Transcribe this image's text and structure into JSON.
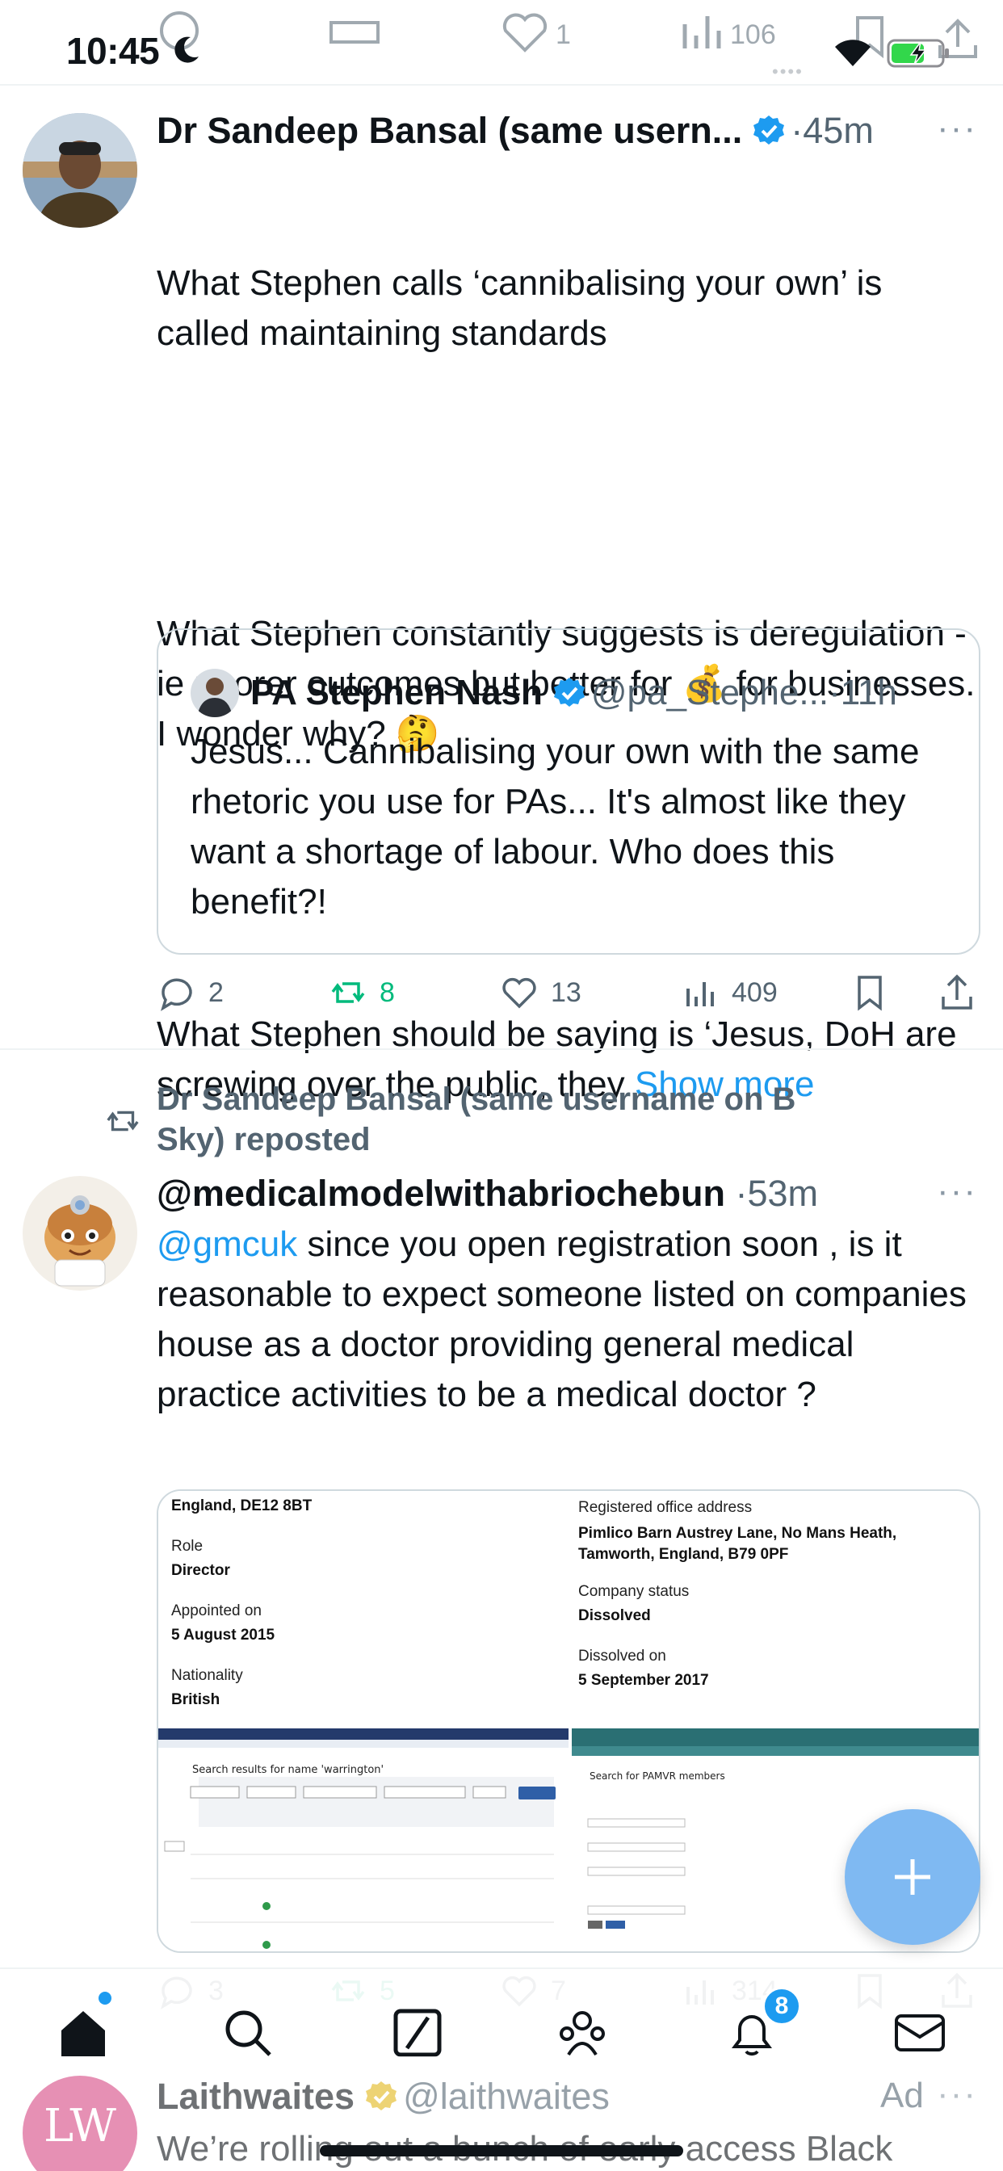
{
  "status_bar": {
    "time": "10:45"
  },
  "top_actions": {
    "retweets": "",
    "likes": "1",
    "views": "106"
  },
  "tweet1": {
    "author": "Dr Sandeep Bansal (same usern...",
    "time": "45m",
    "text_p1": "What Stephen calls ‘cannibalising your own’ is called maintaining standards",
    "text_p2": "What Stephen constantly suggests is deregulation - ie poorer outcomes but better for 💰 for businesses. I wonder why? 🤔",
    "text_p3": "What Stephen should be saying is ‘Jesus, DoH are screwing over the public, they",
    "show_more": "Show more",
    "quote": {
      "author": "PA Stephen Nash",
      "handle": "@pa_Stephe...",
      "time": "11h",
      "text": "Jesus... Cannibalising your own with the same rhetoric you use for PAs... It's almost like they want a shortage of labour. Who does this benefit?!"
    },
    "actions": {
      "replies": "2",
      "reposts": "8",
      "likes": "13",
      "views": "409"
    }
  },
  "tweet2": {
    "repost_banner": "Dr Sandeep Bansal (same username on B Sky) reposted",
    "author": "@medicalmodelwithabriochebun",
    "time": "53m",
    "mention": "@gmcuk",
    "text": " since you open registration soon , is it reasonable to expect someone listed on companies house as a doctor providing general medical practice activities to be a medical doctor ?",
    "media": {
      "doc1": {
        "address": "England, DE12 8BT",
        "role_label": "Role",
        "role_value": "Director",
        "appointed_label": "Appointed on",
        "appointed_value": "5 August 2015",
        "nationality_label": "Nationality",
        "nationality_value": "British"
      },
      "doc2": {
        "office_label": "Registered office address",
        "office_value": "Pimlico Barn Austrey Lane, No Mans Heath, Tamworth, England, B79 0PF",
        "status_label": "Company status",
        "status_value": "Dissolved",
        "dissolved_label": "Dissolved on",
        "dissolved_value": "5 September 2017"
      },
      "doc3": {
        "title": "Search results for name 'warrington'"
      },
      "doc4": {
        "title": "Search for PAMVR members"
      }
    },
    "actions": {
      "replies": "3",
      "reposts": "5",
      "likes": "7",
      "views": "314"
    }
  },
  "nav": {
    "notifications_badge": "8"
  },
  "ad": {
    "avatar_text": "LW",
    "author": "Laithwaites",
    "handle": "@laithwaites",
    "label": "Ad",
    "text": "We’re rolling out a bunch of early access Black"
  },
  "colors": {
    "accent": "#1d9bf0",
    "repost_green": "#00ba7c",
    "muted": "#536471",
    "fab": "#7fb9f2",
    "ad_avatar": "#d64783"
  }
}
